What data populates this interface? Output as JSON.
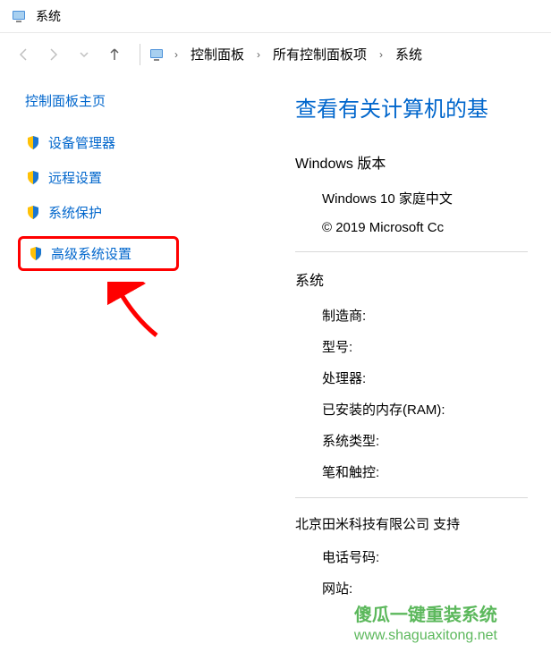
{
  "titlebar": {
    "title": "系统"
  },
  "breadcrumb": {
    "items": [
      "控制面板",
      "所有控制面板项",
      "系统"
    ]
  },
  "sidebar": {
    "title": "控制面板主页",
    "items": [
      {
        "label": "设备管理器"
      },
      {
        "label": "远程设置"
      },
      {
        "label": "系统保护"
      },
      {
        "label": "高级系统设置"
      }
    ]
  },
  "main": {
    "heading": "查看有关计算机的基",
    "windows_section": {
      "label": "Windows 版本",
      "edition": "Windows 10 家庭中文",
      "copyright": "© 2019 Microsoft Cc"
    },
    "system_section": {
      "label": "系统",
      "rows": {
        "manufacturer": "制造商:",
        "model": "型号:",
        "processor": "处理器:",
        "ram": "已安装的内存(RAM):",
        "system_type": "系统类型:",
        "pen_touch": "笔和触控:"
      }
    },
    "support_section": {
      "company": "北京田米科技有限公司 支持",
      "phone_label": "电话号码:",
      "website_label": "网站:"
    }
  },
  "watermark": {
    "text_cn": "傻瓜一键重装系统",
    "url": "www.shaguaxitong.net"
  }
}
